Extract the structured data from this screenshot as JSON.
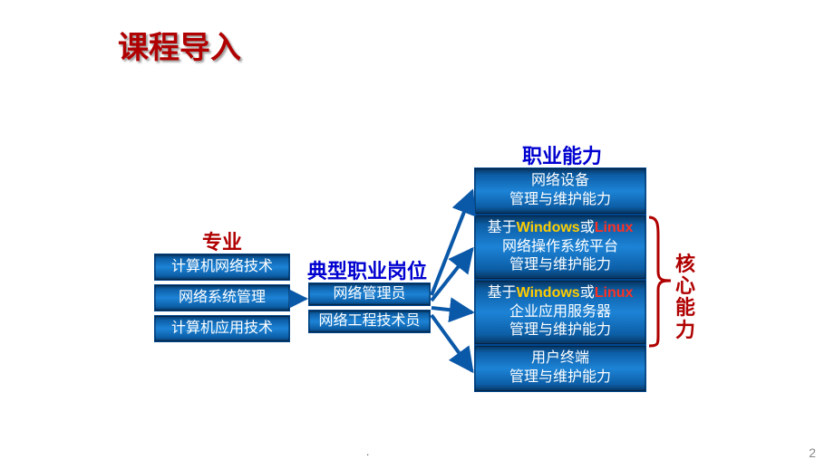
{
  "title": "课程导入",
  "columns": {
    "specialty": {
      "title": "专业",
      "items": [
        "计算机网络技术",
        "网络系统管理",
        "计算机应用技术"
      ]
    },
    "jobs": {
      "title": "典型职业岗位",
      "items": [
        "网络管理员",
        "网络工程技术员"
      ]
    },
    "skills": {
      "title": "职业能力",
      "items": [
        {
          "lines": [
            "网络设备",
            "管理与维护能力"
          ]
        },
        {
          "accent": {
            "prefix": "基于",
            "kw1": "Windows",
            "mid": "或",
            "kw2": "Linux"
          },
          "lines": [
            "网络操作系统平台",
            "管理与维护能力"
          ]
        },
        {
          "accent": {
            "prefix": "基于",
            "kw1": "Windows",
            "mid": "或",
            "kw2": "Linux"
          },
          "lines": [
            "企业应用服务器",
            "管理与维护能力"
          ]
        },
        {
          "lines": [
            "用户终端",
            "管理与维护能力"
          ]
        }
      ]
    }
  },
  "side_label": "核心能力",
  "page_number": "2",
  "footer_mark": "."
}
